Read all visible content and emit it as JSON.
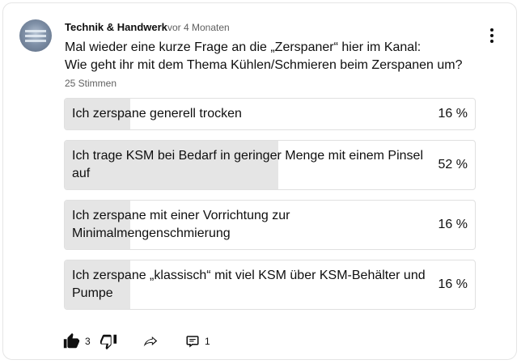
{
  "post": {
    "author": "Technik & Handwerk",
    "age": "vor 4 Monaten",
    "text_lines": [
      "Mal wieder eine kurze Frage an die „Zerspaner“ hier im Kanal:",
      "Wie geht ihr mit dem Thema Kühlen/Schmieren beim Zerspanen um?"
    ],
    "votes": "25 Stimmen"
  },
  "poll": {
    "options": [
      {
        "label_lines": [
          "Ich zerspane generell trocken"
        ],
        "percent_text": "16 %",
        "percent": 16
      },
      {
        "label_lines": [
          "Ich trage KSM bei Bedarf in geringer Menge mit einem Pinsel",
          "auf"
        ],
        "percent_text": "52 %",
        "percent": 52
      },
      {
        "label_lines": [
          "Ich zerspane mit einer Vorrichtung zur",
          "Minimalmengenschmierung"
        ],
        "percent_text": "16 %",
        "percent": 16
      },
      {
        "label_lines": [
          "Ich zerspane „klassisch“ mit viel KSM über KSM-Behälter und",
          "Pumpe"
        ],
        "percent_text": "16 %",
        "percent": 16
      }
    ]
  },
  "actions": {
    "like_count": "3",
    "comment_count": "1",
    "icons": [
      "thumbs-up-icon",
      "thumbs-down-icon",
      "share-icon",
      "comment-icon",
      "more-vert-icon"
    ]
  },
  "colors": {
    "fill": "#e5e5e5",
    "border": "#e0e0e0",
    "meta_text": "#606060",
    "text": "#0f0f0f"
  }
}
